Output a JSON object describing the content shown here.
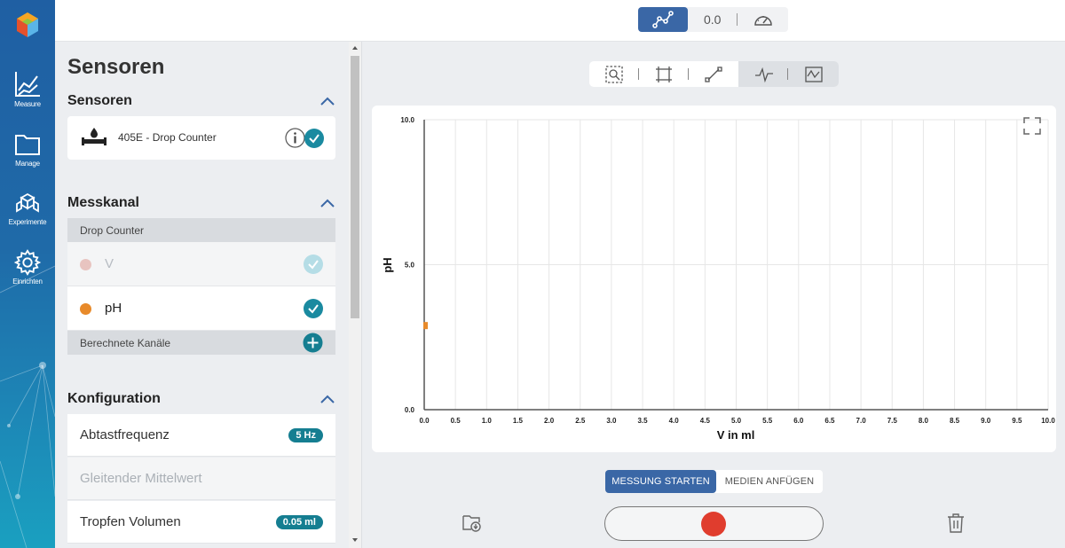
{
  "nav": {
    "items": [
      {
        "label": "Measure",
        "icon": "measure-chart-icon"
      },
      {
        "label": "Manage",
        "icon": "folder-icon"
      },
      {
        "label": "Experimente",
        "icon": "experiments-icon"
      },
      {
        "label": "Einrichten",
        "icon": "gear-icon"
      }
    ]
  },
  "topbar": {
    "numeric_value": "0.0"
  },
  "panel": {
    "title": "Sensoren",
    "sensors_section": {
      "title": "Sensoren",
      "sensor_name": "405E - Drop Counter"
    },
    "channel_section": {
      "title": "Messkanal",
      "group_label": "Drop Counter",
      "channels": [
        {
          "label": "V",
          "color": "#e8c4c0",
          "enabled": false
        },
        {
          "label": "pH",
          "color": "#e88a2a",
          "enabled": true
        }
      ],
      "calculated_label": "Berechnete Kanäle"
    },
    "config_section": {
      "title": "Konfiguration",
      "rows": [
        {
          "label": "Abtastfrequenz",
          "badge": "5 Hz"
        },
        {
          "label": "Gleitender Mittelwert",
          "badge": ""
        },
        {
          "label": "Tropfen Volumen",
          "badge": "0.05 ml"
        }
      ]
    }
  },
  "controls": {
    "start_label": "MESSUNG STARTEN",
    "media_label": "MEDIEN ANFÜGEN"
  },
  "colors": {
    "accent": "#3a67a6",
    "teal": "#1a8aa0",
    "record": "#e03d2e",
    "ph_series": "#e88a2a"
  },
  "chart_data": {
    "type": "scatter",
    "xlabel": "V in ml",
    "ylabel": "pH",
    "xlim": [
      0,
      10
    ],
    "ylim": [
      0,
      10
    ],
    "x_ticks": [
      "0.0",
      "0.5",
      "1.0",
      "1.5",
      "2.0",
      "2.5",
      "3.0",
      "3.5",
      "4.0",
      "4.5",
      "5.0",
      "5.5",
      "6.0",
      "6.5",
      "7.0",
      "7.5",
      "8.0",
      "8.5",
      "9.0",
      "9.5",
      "10.0"
    ],
    "y_ticks": [
      "0.0",
      "5.0",
      "10.0"
    ],
    "grid": true,
    "series": [
      {
        "points": [
          {
            "x": 0.0,
            "y": 2.9
          }
        ]
      }
    ]
  }
}
